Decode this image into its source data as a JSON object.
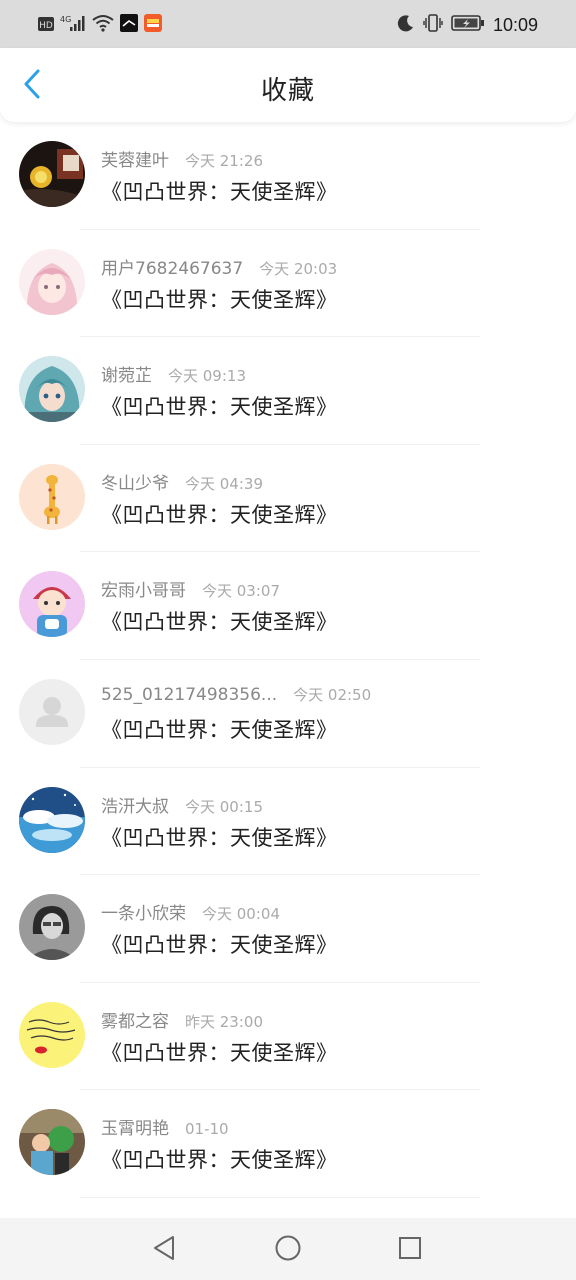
{
  "status_bar": {
    "hd_label": "HD",
    "network_label": "4G",
    "time": "10:09",
    "icons": [
      "hd-icon",
      "signal-icon",
      "wifi-icon",
      "app-notification-icon",
      "app-notification-icon-2",
      "moon-icon",
      "vibrate-icon",
      "battery-icon"
    ]
  },
  "header": {
    "title": "收藏",
    "back_icon": "chevron-left-icon",
    "accent_color": "#2aa1e8"
  },
  "favorites": [
    {
      "username": "芙蓉建叶",
      "time": "今天 21:26",
      "book": "《凹凸世界：天使圣辉》",
      "avatar": "avatar-photo-dark"
    },
    {
      "username": "用户7682467637",
      "time": "今天 20:03",
      "book": "《凹凸世界：天使圣辉》",
      "avatar": "avatar-anime-pink"
    },
    {
      "username": "谢菀芷",
      "time": "今天 09:13",
      "book": "《凹凸世界：天使圣辉》",
      "avatar": "avatar-anime-teal"
    },
    {
      "username": "冬山少爷",
      "time": "今天 04:39",
      "book": "《凹凸世界：天使圣辉》",
      "avatar": "avatar-giraffe"
    },
    {
      "username": "宏雨小哥哥",
      "time": "今天 03:07",
      "book": "《凹凸世界：天使圣辉》",
      "avatar": "avatar-cartoon-boy"
    },
    {
      "username": "525_01217498356...",
      "time": "今天 02:50",
      "book": "《凹凸世界：天使圣辉》",
      "avatar": "avatar-default"
    },
    {
      "username": "浩汧大叔",
      "time": "今天 00:15",
      "book": "《凹凸世界：天使圣辉》",
      "avatar": "avatar-sky-whale"
    },
    {
      "username": "一条小欣荣",
      "time": "今天 00:04",
      "book": "《凹凸世界：天使圣辉》",
      "avatar": "avatar-bw-photo"
    },
    {
      "username": "雾都之容",
      "time": "昨天 23:00",
      "book": "《凹凸世界：天使圣辉》",
      "avatar": "avatar-handwriting"
    },
    {
      "username": "玉霄明艳",
      "time": "01-10",
      "book": "《凹凸世界：天使圣辉》",
      "avatar": "avatar-kid-photo"
    }
  ],
  "nav_bar": {
    "icons": [
      "back-triangle-icon",
      "home-circle-icon",
      "recents-square-icon"
    ]
  }
}
